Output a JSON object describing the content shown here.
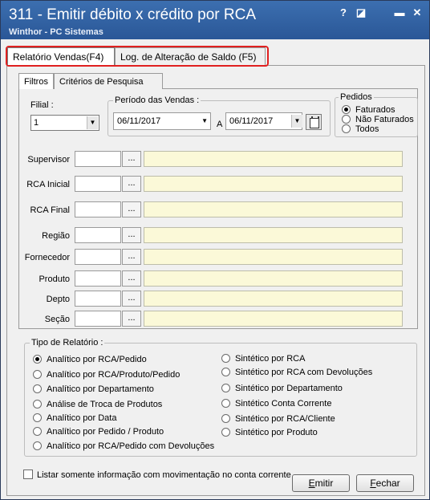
{
  "window": {
    "title": "311 - Emitir débito x crédito por RCA",
    "subtitle": "Winthor - PC Sistemas",
    "buttons": {
      "help": "?",
      "restore": "◪",
      "minimize": "▬",
      "close": "✕"
    }
  },
  "main_tabs": [
    {
      "label": "Relatório Vendas(F4)"
    },
    {
      "label": "Log. de Alteração de Saldo (F5)"
    }
  ],
  "inner_tabs": [
    {
      "label": "Filtros"
    },
    {
      "label": "Critérios de Pesquisa"
    }
  ],
  "filial": {
    "label": "Filial :",
    "value": "1"
  },
  "periodo": {
    "label": "Período das Vendas :",
    "from": "06/11/2017",
    "separator": "A",
    "to": "06/11/2017"
  },
  "pedidos": {
    "label": "Pedidos",
    "options": [
      {
        "label": "Faturados",
        "selected": true
      },
      {
        "label": "Não Faturados",
        "selected": false
      },
      {
        "label": "Todos",
        "selected": false
      }
    ]
  },
  "filters": [
    {
      "label": "Supervisor",
      "button": "..."
    },
    {
      "label": "RCA Inicial",
      "button": "..."
    },
    {
      "label": "RCA Final",
      "button": "..."
    },
    {
      "label": "Região",
      "button": "..."
    },
    {
      "label": "Fornecedor",
      "button": "..."
    },
    {
      "label": "Produto",
      "button": "..."
    },
    {
      "label": "Depto",
      "button": "..."
    },
    {
      "label": "Seção",
      "button": "..."
    }
  ],
  "tipo_relatorio": {
    "label": "Tipo de Relatório :",
    "left": [
      {
        "label": "Analítico por RCA/Pedido",
        "selected": true
      },
      {
        "label": "Analítico por RCA/Produto/Pedido",
        "selected": false
      },
      {
        "label": "Analítico por Departamento",
        "selected": false
      },
      {
        "label": "Análise de Troca de Produtos",
        "selected": false
      },
      {
        "label": "Analítico por Data",
        "selected": false
      },
      {
        "label": "Analítico por Pedido / Produto",
        "selected": false
      },
      {
        "label": "Analítico por RCA/Pedido com Devoluções",
        "selected": false
      }
    ],
    "right": [
      {
        "label": "Sintético por RCA",
        "selected": false
      },
      {
        "label": "Sintético por RCA com Devoluções",
        "selected": false
      },
      {
        "label": "Sintético por Departamento",
        "selected": false
      },
      {
        "label": "Sintético Conta Corrente",
        "selected": false
      },
      {
        "label": "Sintético por RCA/Cliente",
        "selected": false
      },
      {
        "label": "Sintético por Produto",
        "selected": false
      }
    ]
  },
  "option_checkbox": {
    "label": "Listar somente informação com movimentação no conta corrente",
    "checked": false
  },
  "actions": {
    "emitir": {
      "underline": "E",
      "rest": "mitir"
    },
    "fechar": {
      "underline": "F",
      "rest": "echar"
    }
  },
  "colors": {
    "title_bar": "#2a5797",
    "highlight": "#e02020",
    "lookup_field": "#fbf9d8"
  }
}
